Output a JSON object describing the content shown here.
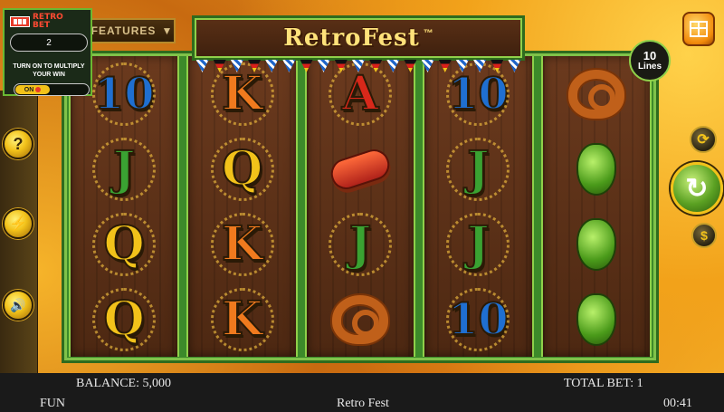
{
  "game": {
    "title": "RetroFest",
    "title_mark": "™",
    "features_label": "FEATURES",
    "features_arrow": "▼"
  },
  "retro_bet": {
    "title_line1": "RETRO",
    "title_line2": "BET",
    "multiplier_value": "2",
    "hint": "TURN ON TO MULTIPLY YOUR WIN",
    "toggle_label": "ON"
  },
  "lines": {
    "count": "10",
    "label": "Lines"
  },
  "left_controls": [
    {
      "name": "help-button",
      "glyph": "?"
    },
    {
      "name": "turbo-button",
      "glyph": "⚡"
    },
    {
      "name": "sound-button",
      "glyph": "🔊"
    }
  ],
  "right_controls": {
    "autoplay_glyph": "⟳",
    "spin_glyph": "↻",
    "bet_glyph": "$"
  },
  "reels": [
    [
      "10",
      "J",
      "Q",
      "Q"
    ],
    [
      "K",
      "Q",
      "K",
      "K"
    ],
    [
      "A",
      "sausage",
      "J",
      "pretzel"
    ],
    [
      "10",
      "J",
      "J",
      "10"
    ],
    [
      "pretzel",
      "hops",
      "hops",
      "hops"
    ]
  ],
  "bottom_bar": {
    "balance": "BALANCE: 5,000",
    "total_bet": "TOTAL BET: 1",
    "mode": "FUN",
    "game_name": "Retro Fest",
    "clock": "00:41"
  },
  "colors": {
    "frame_green": "#3c8a2a",
    "reel_wood": "#6b3a1e",
    "gold": "#f2c21a",
    "bottom_bar": "#1a1a1a"
  }
}
